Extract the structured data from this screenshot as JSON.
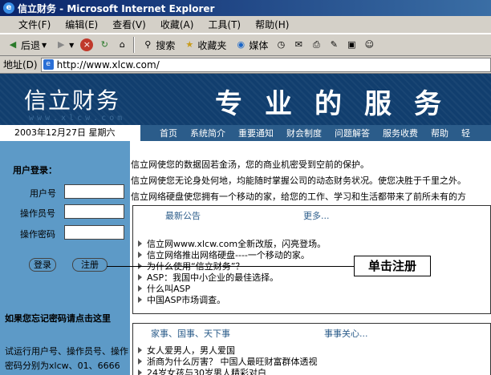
{
  "window": {
    "title": "信立财务 - Microsoft Internet Explorer"
  },
  "menu": [
    "文件(F)",
    "编辑(E)",
    "查看(V)",
    "收藏(A)",
    "工具(T)",
    "帮助(H)"
  ],
  "toolbar": {
    "back": "后退",
    "search": "搜索",
    "favorites": "收藏夹",
    "media": "媒体"
  },
  "address": {
    "label": "地址(D)",
    "url": "http://www.xlcw.com/"
  },
  "site": {
    "logo": "信立财务",
    "logo_url": "www.xlcw.com",
    "slogan": "专业的服务",
    "date": "2003年12月27日 星期六",
    "nav": [
      "首页",
      "系统简介",
      "重要通知",
      "财会制度",
      "问题解答",
      "服务收费",
      "帮助",
      "轻"
    ]
  },
  "login": {
    "title": "用户登录：",
    "user_label": "用户号",
    "operator_label": "操作员号",
    "password_label": "操作密码",
    "login_button": "登录",
    "register_button": "注册",
    "forgot": "如果您忘记密码请点击这里",
    "trial": "试运行用户号、操作员号、操作密码分别为xlcw、01、6666"
  },
  "intro": [
    "信立网使您的数据固若金汤，您的商业机密受到空前的保护。",
    "信立网使您无论身处何地，均能随时掌握公司的动态财务状况。使您决胜于千里之外。",
    "信立网络硬盘使您拥有一个移动的家，给您的工作、学习和生活都带来了前所未有的方"
  ],
  "announcements": {
    "title": "最新公告",
    "more": "更多...",
    "items": [
      "信立网www.xlcw.com全新改版，闪亮登场。",
      "信立网络推出网络硬盘----一个移动的家。",
      "为什么使用“信立财务”？",
      "ASP：我国中小企业的最佳选择。",
      "什么叫ASP",
      "中国ASP市场调查。"
    ]
  },
  "news": {
    "title": "家事、国事、天下事",
    "more": "事事关心...",
    "items": [
      "女人爱男人，男人爱国",
      "浙商为什么厉害？ 中国人最旺财富群体透视",
      "24岁女孩与30岁男人精彩对白"
    ]
  },
  "callout": {
    "text": "单击注册"
  }
}
